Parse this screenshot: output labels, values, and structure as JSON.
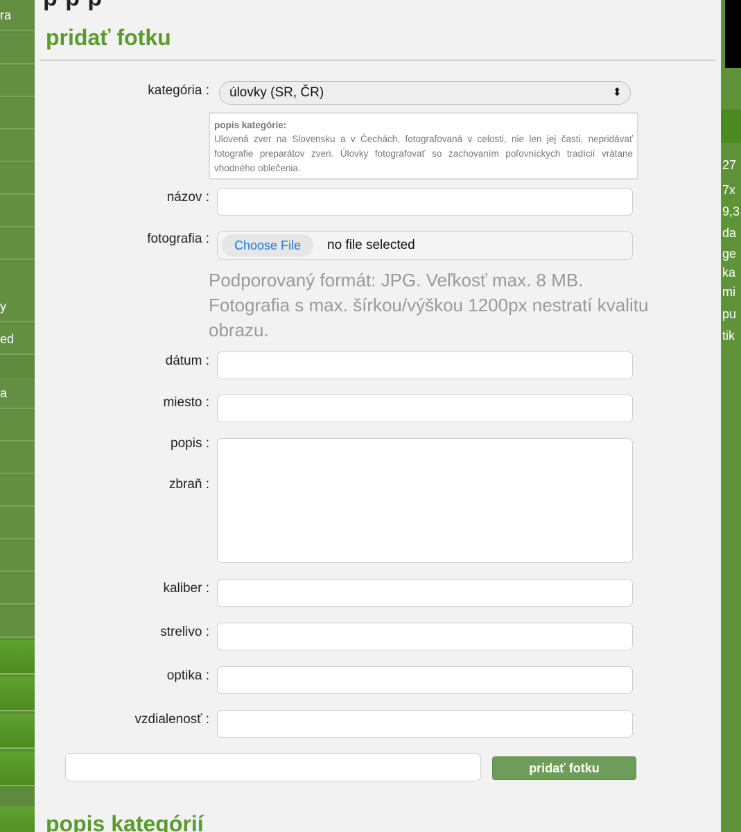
{
  "left_sidebar": {
    "items": [
      {
        "label": "ra"
      },
      {
        "label": ""
      },
      {
        "label": ""
      },
      {
        "label": ""
      },
      {
        "label": ""
      },
      {
        "label": ""
      },
      {
        "label": ""
      },
      {
        "label": ""
      },
      {
        "label": ""
      },
      {
        "label": "y"
      },
      {
        "label": "ed"
      },
      {
        "label": "a"
      },
      {
        "label": ""
      },
      {
        "label": ""
      },
      {
        "label": ""
      },
      {
        "label": ""
      },
      {
        "label": ""
      },
      {
        "label": ""
      },
      {
        "label": ""
      },
      {
        "label": ""
      },
      {
        "label": ""
      },
      {
        "label": ""
      },
      {
        "label": ""
      }
    ]
  },
  "main": {
    "top_partial_heading": "p    p    p",
    "form_title": "pridať fotku",
    "bottom_title": "popis kategórií",
    "form": {
      "category_label": "kategória :",
      "category_value": "úlovky (SR, ČR)",
      "category_desc_title": "popis kategórie:",
      "category_desc_text": "Ulovená zver na Slovensku a v Čechách, fotografovaná v celosti, nie len jej časti, nepridávať fotografie preparátov zveri. Úlovky fotografovať so zachovaním poľovníckych tradícií vrátane vhodného oblečenia.",
      "name_label": "názov :",
      "photo_label": "fotografia :",
      "file_button": "Choose File",
      "file_status": "no file selected",
      "photo_hint": "Podporovaný formát: JPG. Veľkosť max. 8 MB. Fotografia s max. šírkou/výškou 1200px nestratí kvalitu obrazu.",
      "date_label": "dátum :",
      "place_label": "miesto :",
      "description_label": "popis :",
      "weapon_label": "zbraň :",
      "caliber_label": "kaliber :",
      "ammo_label": "strelivo :",
      "optics_label": "optika :",
      "distance_label": "vzdialenosť :",
      "submit_label": "pridať fotku"
    }
  },
  "right_sidebar": {
    "lines": [
      "27",
      "7x",
      "9,3",
      "da",
      "ge",
      "ka",
      "mi",
      "pu",
      "tik"
    ]
  }
}
